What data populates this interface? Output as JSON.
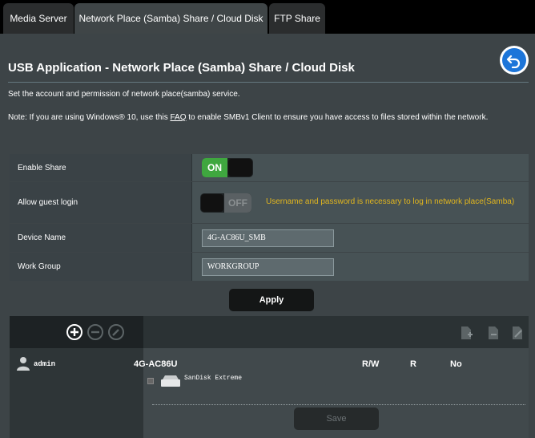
{
  "tabs": [
    {
      "label": "Media Server"
    },
    {
      "label": "Network Place (Samba) Share / Cloud Disk"
    },
    {
      "label": "FTP Share"
    }
  ],
  "header": {
    "title": "USB Application - Network Place (Samba) Share / Cloud Disk"
  },
  "description": "Set the account and permission of network place(samba) service.",
  "note": {
    "before": "Note: If you are using Windows® 10, use this ",
    "link": "FAQ",
    "after": " to enable SMBv1 Client to ensure you have access to files stored within the network."
  },
  "form": {
    "enable_share": {
      "label": "Enable Share",
      "state": "ON"
    },
    "guest_login": {
      "label": "Allow guest login",
      "state": "OFF",
      "hint": "Username and password is necessary to log in network place(Samba)"
    },
    "device_name": {
      "label": "Device Name",
      "value": "4G-AC86U_SMB"
    },
    "work_group": {
      "label": "Work Group",
      "value": "WORKGROUP"
    }
  },
  "apply_label": "Apply",
  "accounts": {
    "user": "admin",
    "device": "4G-AC86U",
    "permission_cols": [
      "R/W",
      "R",
      "No"
    ],
    "disk": "SanDisk Extreme",
    "save_label": "Save"
  },
  "colors": {
    "accent_green": "#3fa73f",
    "hint_yellow": "#e2b61e",
    "panel_bg": "#3d4447",
    "back_blue": "#1c75d9"
  }
}
